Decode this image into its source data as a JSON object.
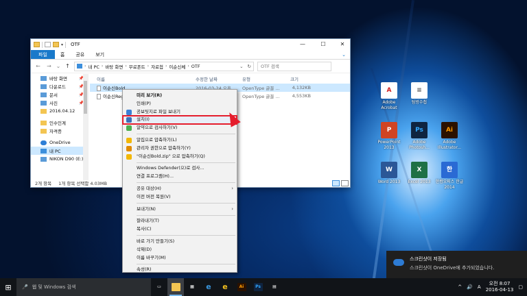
{
  "window": {
    "title": "OTF",
    "minimize": "—",
    "maximize": "☐",
    "close": "✕"
  },
  "ribbon": {
    "tabs": [
      "파일",
      "홈",
      "공유",
      "보기"
    ]
  },
  "address": {
    "back": "←",
    "forward": "→",
    "recent": "⌄",
    "up": "↑",
    "crumbs": [
      "내 PC",
      "바탕 화면",
      "무료폰트",
      "자료첩",
      "이순신체",
      "OTF"
    ],
    "dropdown": "⌄",
    "refresh": "↻"
  },
  "search": {
    "placeholder": "OTF 검색"
  },
  "nav": {
    "items": [
      {
        "label": "바탕 화면",
        "icon": "desktop-icon",
        "pinned": true
      },
      {
        "label": "다운로드",
        "icon": "download-icon",
        "pinned": true
      },
      {
        "label": "문서",
        "icon": "document-icon",
        "pinned": true
      },
      {
        "label": "사진",
        "icon": "picture-icon",
        "pinned": true
      },
      {
        "label": "2016.04.12",
        "icon": "folder-icon",
        "pinned": false
      },
      {
        "label": "인수인계",
        "icon": "folder-icon",
        "pinned": false
      },
      {
        "label": "자격증",
        "icon": "folder-icon",
        "pinned": false
      },
      {
        "label": "OneDrive",
        "icon": "onedrive-icon",
        "pinned": false
      },
      {
        "label": "내 PC",
        "icon": "pc-icon",
        "pinned": false
      },
      {
        "label": "NIKON D90 (E:)",
        "icon": "drive-icon",
        "pinned": false
      }
    ],
    "pin_glyph": "📌"
  },
  "columns": {
    "name": "이름",
    "date": "수정한 날짜",
    "type": "유형",
    "size": "크기"
  },
  "files": [
    {
      "name": "이순신Bold",
      "date": "2016-03-24 오후",
      "type": "OpenType 글꼴 ...",
      "size": "4,132KB",
      "selected": true
    },
    {
      "name": "이순신Reg",
      "date": "2016-03-24 오후",
      "type": "OpenType 글꼴 ...",
      "size": "4,553KB",
      "selected": false
    }
  ],
  "status": {
    "count": "2개 항목",
    "selection": "1개 항목 선택함 4.03MB"
  },
  "context_menu": [
    {
      "label": "미리 보기(R)",
      "bold": true
    },
    {
      "label": "인쇄(P)"
    },
    {
      "label": "공보팃지로 파일 보내기",
      "icon": "bluetooth-share-icon"
    },
    {
      "label": "설치(I)",
      "icon": "shield-icon",
      "highlight": true
    },
    {
      "label": "알약으로 검사하기(V)",
      "icon": "alyac-icon"
    },
    {
      "sep": true
    },
    {
      "label": "알집으로 압축하기(L)",
      "icon": "alzip-icon"
    },
    {
      "label": "관리자 권한으로 압축하기(Y)",
      "icon": "alzip-admin-icon"
    },
    {
      "label": "\"이순신Bold.zip\" 으로 압축하기(Q)",
      "icon": "alzip-icon"
    },
    {
      "sep": true
    },
    {
      "label": "Windows Defender(으)로 검사..."
    },
    {
      "label": "연결 프로그램(H)..."
    },
    {
      "sep": true
    },
    {
      "label": "공유 대상(H)",
      "submenu": true
    },
    {
      "label": "이전 버전 복원(V)"
    },
    {
      "sep": true
    },
    {
      "label": "보내기(N)",
      "submenu": true
    },
    {
      "sep": true
    },
    {
      "label": "잘라내기(T)"
    },
    {
      "label": "복사(C)"
    },
    {
      "sep": true
    },
    {
      "label": "바로 가기 만들기(S)"
    },
    {
      "label": "삭제(D)"
    },
    {
      "label": "이름 바꾸기(M)"
    },
    {
      "sep": true
    },
    {
      "label": "속성(R)"
    }
  ],
  "desktop_icons": [
    {
      "label": "Adobe Acrobat",
      "glyph": "A",
      "color": "#ffffff",
      "text": "#d11f1f",
      "icon": "acrobat-icon"
    },
    {
      "label": "탐방수첩",
      "glyph": "≡",
      "color": "#ffffff",
      "text": "#555555",
      "icon": "document-icon"
    },
    {
      "label": "PowerPoint 2013",
      "glyph": "P",
      "color": "#d04423",
      "text": "#ffffff",
      "icon": "powerpoint-icon"
    },
    {
      "label": "Adobe Photosh...",
      "glyph": "Ps",
      "color": "#0f2440",
      "text": "#31a8ff",
      "icon": "photoshop-icon"
    },
    {
      "label": "Adobe Illustrator...",
      "glyph": "Ai",
      "color": "#2b1100",
      "text": "#ff9a00",
      "icon": "illustrator-icon"
    },
    {
      "label": "Word 2013",
      "glyph": "W",
      "color": "#2b5797",
      "text": "#ffffff",
      "icon": "word-icon"
    },
    {
      "label": "Excel 2013",
      "glyph": "X",
      "color": "#1e7145",
      "text": "#ffffff",
      "icon": "excel-icon"
    },
    {
      "label": "한컴오피스 한글 2014",
      "glyph": "한",
      "color": "#2a6ad4",
      "text": "#ffffff",
      "icon": "hancom-icon"
    }
  ],
  "toast": {
    "title": "스크린샷이 저장됨",
    "body": "스크린샷이 OneDrive에 추가되었습니다."
  },
  "taskbar": {
    "search_placeholder": "웹 및 Windows 검색",
    "start_glyph": "⊞",
    "mic_glyph": "🎤",
    "apps": [
      {
        "icon": "task-view-icon",
        "glyph": "▭",
        "color": "transparent"
      },
      {
        "icon": "file-explorer-icon",
        "glyph": "",
        "color": "#f3c552",
        "active": true
      },
      {
        "icon": "store-icon",
        "glyph": "▦",
        "color": "transparent"
      },
      {
        "icon": "edge-icon",
        "glyph": "e",
        "color": "transparent",
        "text": "#3a96dd"
      },
      {
        "icon": "ie-icon",
        "glyph": "e",
        "color": "transparent",
        "text": "#f4c01f"
      },
      {
        "icon": "illustrator-icon",
        "glyph": "Ai",
        "color": "#2b1100",
        "text": "#ff9a00"
      },
      {
        "icon": "photoshop-icon",
        "glyph": "Ps",
        "color": "#0f2440",
        "text": "#31a8ff"
      },
      {
        "icon": "calculator-icon",
        "glyph": "▤",
        "color": "transparent"
      }
    ],
    "tray_chevron": "^",
    "volume": "🔊",
    "lang": "A",
    "time": "오전 8:07",
    "date": "2016-04-13",
    "notif": "▢"
  }
}
